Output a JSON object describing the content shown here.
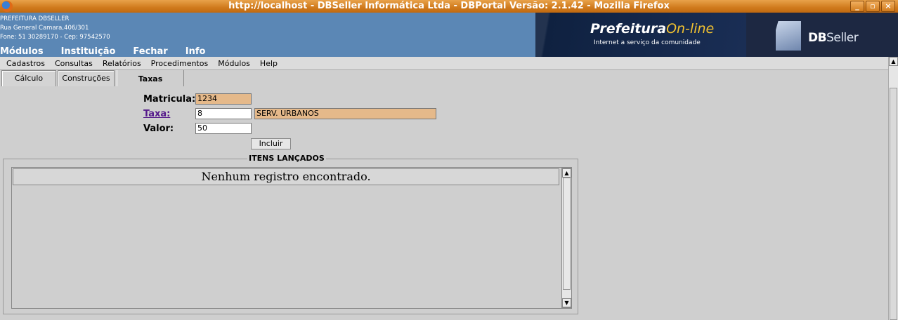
{
  "window": {
    "title": "http://localhost - DBSeller Informática Ltda - DBPortal Versão: 2.1.42 - Mozilla Firefox",
    "controls": [
      "_",
      "▫",
      "×"
    ]
  },
  "header": {
    "org_name": "PREFEITURA DBSELLER",
    "address": "Rua General Camara,406/301",
    "phone": "Fone: 51 30289170  -  Cep: 97542570",
    "top_menu": [
      "Módulos",
      "Instituição",
      "Fechar",
      "Info"
    ],
    "brand_prefix": "Prefeitura",
    "brand_suffix": "On-line",
    "brand_tagline": "Internet a serviço da comunidade",
    "db_bold": "DB",
    "db_light": "Seller"
  },
  "menubar": [
    "Cadastros",
    "Consultas",
    "Relatórios",
    "Procedimentos",
    "Módulos",
    "Help"
  ],
  "tabs": [
    {
      "label": "Cálculo"
    },
    {
      "label": "Construções"
    },
    {
      "label": "Taxas"
    }
  ],
  "form": {
    "matricula_label": "Matricula:",
    "matricula_value": "1234",
    "taxa_label": "Taxa:",
    "taxa_code": "8",
    "taxa_desc": "SERV. URBANOS",
    "valor_label": "Valor:",
    "valor_value": "50",
    "incluir_label": "Incluir"
  },
  "items": {
    "legend": "ITENS LANÇADOS",
    "empty_message": "Nenhum registro encontrado."
  },
  "colors": {
    "readonly_field": "#e5b98a",
    "banner": "#5b87b5",
    "titlebar": "#d07a1c"
  }
}
